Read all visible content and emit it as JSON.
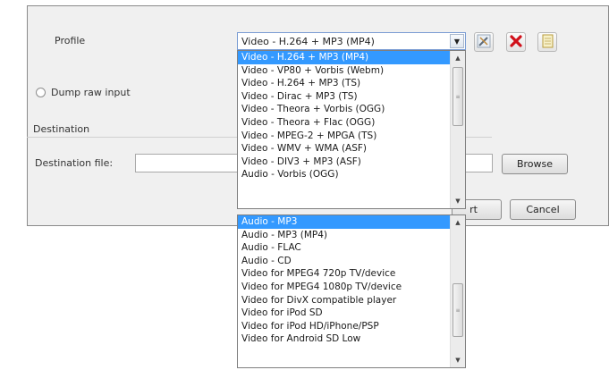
{
  "profile": {
    "label": "Profile",
    "selected": "Video - H.264 + MP3 (MP4)"
  },
  "icons": {
    "edit": "wrench-pencil-icon",
    "delete": "red-x-icon",
    "new": "new-document-icon",
    "delete_color": "#d0101a"
  },
  "dump_raw_input": {
    "label": "Dump raw input",
    "checked": false
  },
  "destination": {
    "section_label": "Destination",
    "file_label": "Destination file:",
    "file_value": ""
  },
  "buttons": {
    "browse": "Browse",
    "start": "rt",
    "cancel": "Cancel"
  },
  "dropdown_page1": {
    "items": [
      "Video - H.264 + MP3 (MP4)",
      "Video - VP80 + Vorbis (Webm)",
      "Video - H.264 + MP3 (TS)",
      "Video - Dirac + MP3 (TS)",
      "Video - Theora + Vorbis (OGG)",
      "Video - Theora + Flac (OGG)",
      "Video - MPEG-2 + MPGA (TS)",
      "Video - WMV + WMA (ASF)",
      "Video - DIV3 + MP3 (ASF)",
      "Audio - Vorbis (OGG)"
    ],
    "selected_index": 0
  },
  "dropdown_page2": {
    "items": [
      "Audio - MP3",
      "Audio - MP3 (MP4)",
      "Audio - FLAC",
      "Audio - CD",
      "Video for MPEG4 720p TV/device",
      "Video for MPEG4 1080p TV/device",
      "Video for DivX compatible player",
      "Video for iPod SD",
      "Video for iPod HD/iPhone/PSP",
      "Video for Android SD Low"
    ],
    "selected_index": 0
  },
  "colors": {
    "selection": "#3399ff",
    "dialog_bg": "#f0f0f0",
    "combo_border": "#7a9cd3"
  }
}
